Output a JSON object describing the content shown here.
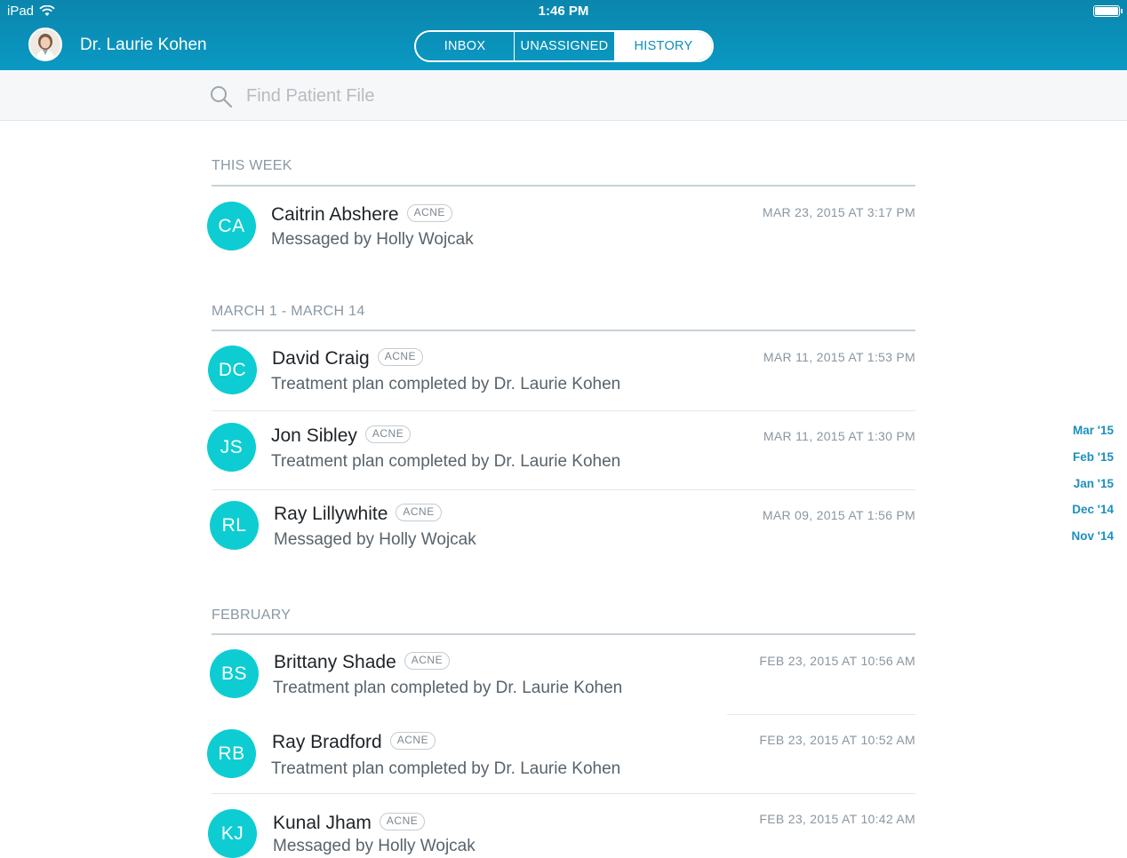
{
  "status_bar": {
    "device": "iPad",
    "time": "1:46 PM"
  },
  "header": {
    "doctor_name": "Dr. Laurie Kohen",
    "tabs": [
      {
        "label": "INBOX",
        "active": false
      },
      {
        "label": "UNASSIGNED",
        "active": false
      },
      {
        "label": "HISTORY",
        "active": true
      }
    ]
  },
  "search": {
    "placeholder": "Find Patient File"
  },
  "sections": [
    {
      "title": "THIS WEEK",
      "items": [
        {
          "initials": "CA",
          "name": "Caitrin Abshere",
          "tag": "ACNE",
          "description": "Messaged by Holly Wojcak",
          "date": "MAR 23, 2015 AT 3:17 PM"
        }
      ]
    },
    {
      "title": "MARCH 1 - MARCH 14",
      "items": [
        {
          "initials": "DC",
          "name": "David Craig",
          "tag": "ACNE",
          "description": "Treatment plan completed by Dr. Laurie Kohen",
          "date": "MAR 11, 2015 AT 1:53 PM"
        },
        {
          "initials": "JS",
          "name": "Jon Sibley",
          "tag": "ACNE",
          "description": "Treatment plan completed by Dr. Laurie Kohen",
          "date": "MAR 11, 2015 AT 1:30 PM"
        },
        {
          "initials": "RL",
          "name": "Ray Lillywhite",
          "tag": "ACNE",
          "description": "Messaged by Holly Wojcak",
          "date": "MAR 09, 2015 AT 1:56 PM"
        }
      ]
    },
    {
      "title": "FEBRUARY",
      "items": [
        {
          "initials": "BS",
          "name": "Brittany Shade",
          "tag": "ACNE",
          "description": "Treatment plan completed by Dr. Laurie Kohen",
          "date": "FEB 23, 2015 AT 10:56 AM"
        },
        {
          "initials": "RB",
          "name": "Ray Bradford",
          "tag": "ACNE",
          "description": "Treatment plan completed by Dr. Laurie Kohen",
          "date": "FEB 23, 2015 AT 10:52 AM"
        },
        {
          "initials": "KJ",
          "name": "Kunal Jham",
          "tag": "ACNE",
          "description": "Messaged by Holly Wojcak",
          "date": "FEB 23, 2015 AT 10:42 AM"
        }
      ]
    }
  ],
  "month_index": [
    "Mar '15",
    "Feb '15",
    "Jan '15",
    "Dec '14",
    "Nov '14"
  ],
  "colors": {
    "header": "#0a94bd",
    "avatar": "#0dcdd2",
    "index_link": "#1c8fc0"
  }
}
